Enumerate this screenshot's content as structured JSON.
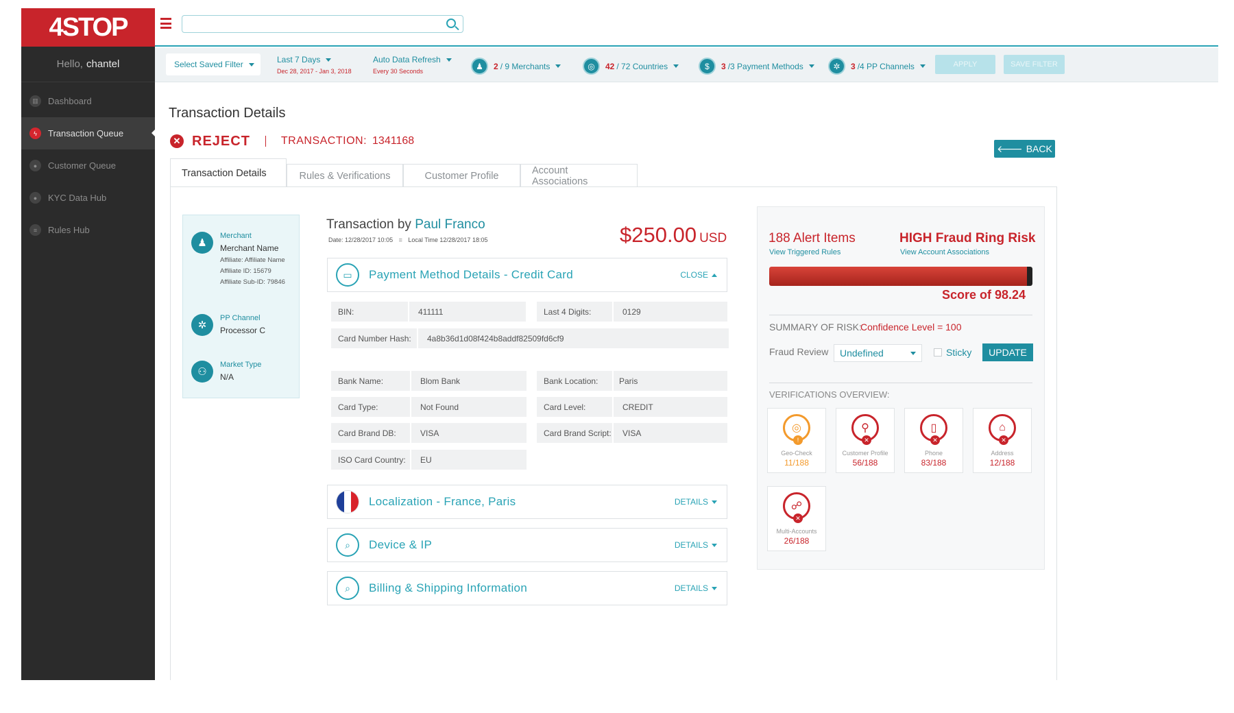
{
  "app": {
    "logo": "4STOP",
    "greeting": "Hello,",
    "username": "chantel"
  },
  "sidebar": {
    "items": [
      {
        "label": "Dashboard",
        "icon": "chart-icon",
        "active": false
      },
      {
        "label": "Transaction Queue",
        "icon": "lightning-icon",
        "active": true
      },
      {
        "label": "Customer Queue",
        "icon": "group-icon",
        "active": false
      },
      {
        "label": "KYC Data Hub",
        "icon": "person-icon",
        "active": false
      },
      {
        "label": "Rules Hub",
        "icon": "list-icon",
        "active": false
      }
    ]
  },
  "search": {
    "value": "",
    "placeholder": ""
  },
  "filters": {
    "saved_filter": "Select Saved Filter",
    "date_range_label": "Last 7 Days",
    "date_range_value": "Dec 28, 2017 - Jan 3, 2018",
    "refresh_label": "Auto Data Refresh",
    "refresh_value": "Every 30 Seconds",
    "merchants": {
      "selected": "2",
      "rest": "/ 9 Merchants"
    },
    "countries": {
      "selected": "42",
      "rest": "/ 72 Countries"
    },
    "payment_methods": {
      "selected": "3",
      "rest": "/3 Payment Methods"
    },
    "pp_channels": {
      "selected": "3",
      "rest": "/4 PP Channels"
    },
    "apply_label": "APPLY",
    "save_filter_label": "SAVE FILTER"
  },
  "page": {
    "title": "Transaction Details",
    "status": "REJECT",
    "transaction_label": "TRANSACTION:",
    "transaction_id": "1341168",
    "back_label": "BACK"
  },
  "tabs": [
    {
      "label": "Transaction Details",
      "active": true
    },
    {
      "label": "Rules & Verifications",
      "active": false
    },
    {
      "label": "Customer Profile",
      "active": false
    },
    {
      "label": "Account Associations",
      "active": false
    }
  ],
  "merchant_info": {
    "merchant_label": "Merchant",
    "merchant_name": "Merchant Name",
    "affiliate": "Affiliate: Affiliate Name",
    "affiliate_id": "Affiliate ID: 15679",
    "affiliate_sub_id": "Affiliate Sub-ID:  79846",
    "pp_channel_label": "PP Channel",
    "pp_channel_value": "Processor C",
    "market_type_label": "Market Type",
    "market_type_value": "N/A"
  },
  "transaction": {
    "by_prefix": "Transaction by",
    "customer": "Paul Franco",
    "date": "Date: 12/28/2017 10:05",
    "separator": "=",
    "local_time": "Local Time 12/28/2017 18:05",
    "amount": "$250.00",
    "currency": "USD"
  },
  "payment_section": {
    "title": "Payment Method Details - Credit Card",
    "action": "CLOSE",
    "bin_label": "BIN:",
    "bin_value": "411111",
    "last4_label": "Last 4 Digits:",
    "last4_value": "0129",
    "hash_label": "Card Number Hash:",
    "hash_value": "4a8b36d1d08f424b8addf82509fd6cf9",
    "bank_name_label": "Bank Name:",
    "bank_name_value": "Blom Bank",
    "bank_location_label": "Bank Location:",
    "bank_location_value": "Paris",
    "card_type_label": "Card Type:",
    "card_type_value": "Not Found",
    "card_level_label": "Card Level:",
    "card_level_value": "CREDIT",
    "brand_db_label": "Card Brand DB:",
    "brand_db_value": "VISA",
    "brand_script_label": "Card Brand Script:",
    "brand_script_value": "VISA",
    "iso_label": "ISO Card Country:",
    "iso_value": "EU"
  },
  "sections": [
    {
      "title": "Localization - France, Paris",
      "action": "DETAILS"
    },
    {
      "title": "Device & IP",
      "action": "DETAILS"
    },
    {
      "title": "Billing & Shipping Information",
      "action": "DETAILS"
    }
  ],
  "risk": {
    "alert_items": "188 Alert Items",
    "alert_link": "View Triggered Rules",
    "ring_risk": "HIGH Fraud Ring Risk",
    "ring_link": "View Account Associations",
    "score": 98.24,
    "score_text": "Score of 98.24",
    "summary_label": "SUMMARY OF RISK:",
    "summary_value": "Confidence Level = 100",
    "fraud_review_label": "Fraud Review",
    "fraud_review_value": "Undefined",
    "sticky_label": "Sticky",
    "update_label": "UPDATE",
    "verifications_label": "VERIFICATIONS OVERVIEW:"
  },
  "verifications": [
    {
      "name": "Geo-Check",
      "count": "11/188",
      "status": "warning",
      "icon": "globe-icon"
    },
    {
      "name": "Customer Profile",
      "count": "56/188",
      "status": "fail",
      "icon": "user-search-icon"
    },
    {
      "name": "Phone",
      "count": "83/188",
      "status": "fail",
      "icon": "phone-icon"
    },
    {
      "name": "Address",
      "count": "12/188",
      "status": "fail",
      "icon": "home-icon"
    },
    {
      "name": "Multi-Accounts",
      "count": "26/188",
      "status": "fail",
      "icon": "network-icon"
    }
  ],
  "colors": {
    "brand_red": "#c8242b",
    "accent_teal": "#1f8ea0",
    "sidebar_bg": "#2b2b2b",
    "warning_orange": "#f39a2c"
  }
}
